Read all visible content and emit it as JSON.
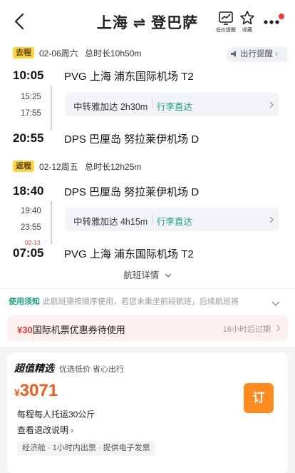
{
  "header": {
    "title": "上海 ⇌ 登巴萨",
    "low_price_label": "低价提醒",
    "favorite_label": "收藏"
  },
  "outbound": {
    "tag": "去程",
    "date": "02-06周六",
    "duration": "总时长10h50m",
    "remind_label": "出行提醒",
    "depart_time": "10:05",
    "depart_airport": "PVG  上海  浦东国际机场  T2",
    "transfer_arrive": "15:25",
    "transfer_depart": "17:55",
    "transfer_info": "中转雅加达 2h30m",
    "baggage_through": "行李直达",
    "arrive_time": "20:55",
    "arrive_airport": "DPS  巴厘岛  努拉莱伊机场  D"
  },
  "inbound": {
    "tag": "返程",
    "date": "02-12周五",
    "duration": "总时长12h25m",
    "depart_time": "18:40",
    "depart_airport": "DPS  巴厘岛  努拉莱伊机场  D",
    "transfer_arrive": "19:40",
    "transfer_depart": "23:55",
    "transfer_info": "中转雅加达 4h15m",
    "baggage_through": "行李直达",
    "arrive_next_date": "02-13",
    "arrive_time": "07:05",
    "arrive_airport": "PVG  上海  浦东国际机场  T2"
  },
  "details_label": "航班详情",
  "notice": {
    "key": "使用须知",
    "text": "此航班需按顺序使用，若您未乘坐前段航班，后续航班将"
  },
  "coupon": {
    "amount": "¥30",
    "text": "国际机票优惠券待使用",
    "expiry": "16小时后过期"
  },
  "offer": {
    "brand": "超值精选",
    "slogan": "优选低价 省心出行",
    "currency": "¥",
    "price": "3071",
    "baggage": "每程每人托运30公斤",
    "refund": "查看退改说明",
    "extras": "经济舱 · 1小时内出票 · 提供电子发票",
    "book_label": "订"
  },
  "colors": {
    "accent_green": "#1aa37a",
    "price_orange": "#f25a1d",
    "book_orange": "#ff8a1f",
    "tag_yellow": "#ffd63f",
    "red": "#e23b2f"
  }
}
